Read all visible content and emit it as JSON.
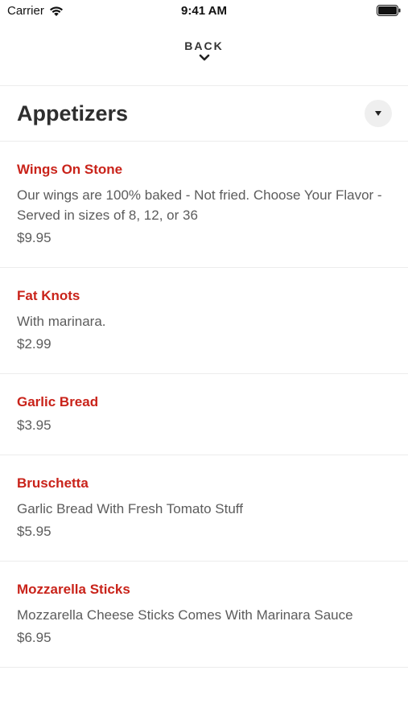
{
  "status_bar": {
    "carrier": "Carrier",
    "time": "9:41 AM"
  },
  "header": {
    "back_label": "BACK"
  },
  "section": {
    "title": "Appetizers"
  },
  "items": [
    {
      "name": "Wings On Stone",
      "description": "Our wings are 100% baked - Not fried. Choose Your Flavor - Served in sizes of 8, 12, or 36",
      "price": "$9.95"
    },
    {
      "name": "Fat Knots",
      "description": "With marinara.",
      "price": "$2.99"
    },
    {
      "name": "Garlic Bread",
      "description": "",
      "price": "$3.95"
    },
    {
      "name": "Bruschetta",
      "description": "Garlic Bread With Fresh Tomato Stuff",
      "price": "$5.95"
    },
    {
      "name": "Mozzarella Sticks",
      "description": "Mozzarella Cheese Sticks Comes With Marinara Sauce",
      "price": "$6.95"
    }
  ],
  "colors": {
    "item_name": "#c9231a",
    "text_secondary": "#5c5c5c",
    "title": "#2e2e2e",
    "divider": "#ececec"
  }
}
